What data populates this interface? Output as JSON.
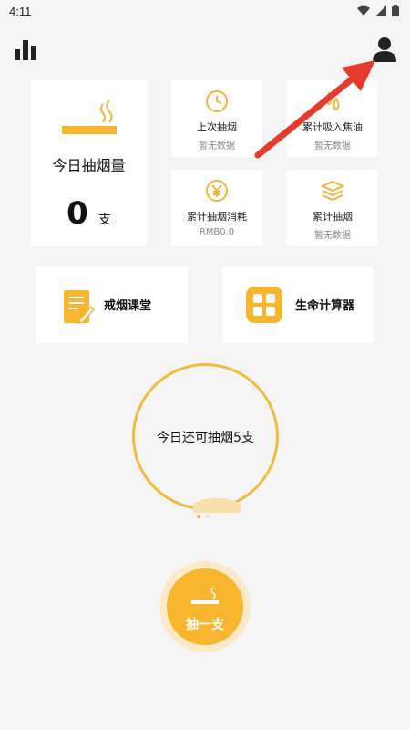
{
  "status_bar": {
    "time": "4:11"
  },
  "today": {
    "title": "今日抽烟量",
    "count": "0",
    "unit": "支"
  },
  "stats": [
    {
      "title": "上次抽烟",
      "value": "暂无数据",
      "icon": "clock-icon"
    },
    {
      "title": "累计吸入焦油",
      "value": "暂无数据",
      "icon": "drops-icon"
    },
    {
      "title": "累计抽烟消耗",
      "value": "RMB0.0",
      "icon": "yen-icon"
    },
    {
      "title": "累计抽烟",
      "value": "暂无数据",
      "icon": "layers-icon"
    }
  ],
  "features": {
    "course": {
      "label": "戒烟课堂",
      "icon": "notebook-pen-icon"
    },
    "calculator": {
      "label": "生命计算器",
      "icon": "calculator-icon"
    }
  },
  "remaining": {
    "text": "今日还可抽烟5支"
  },
  "pager": {
    "current": 1,
    "total": 2
  },
  "smoke_button": {
    "label": "抽一支"
  },
  "colors": {
    "accent": "#f7b62d",
    "arrow": "#e53b2c",
    "background": "#f5f5f5"
  }
}
